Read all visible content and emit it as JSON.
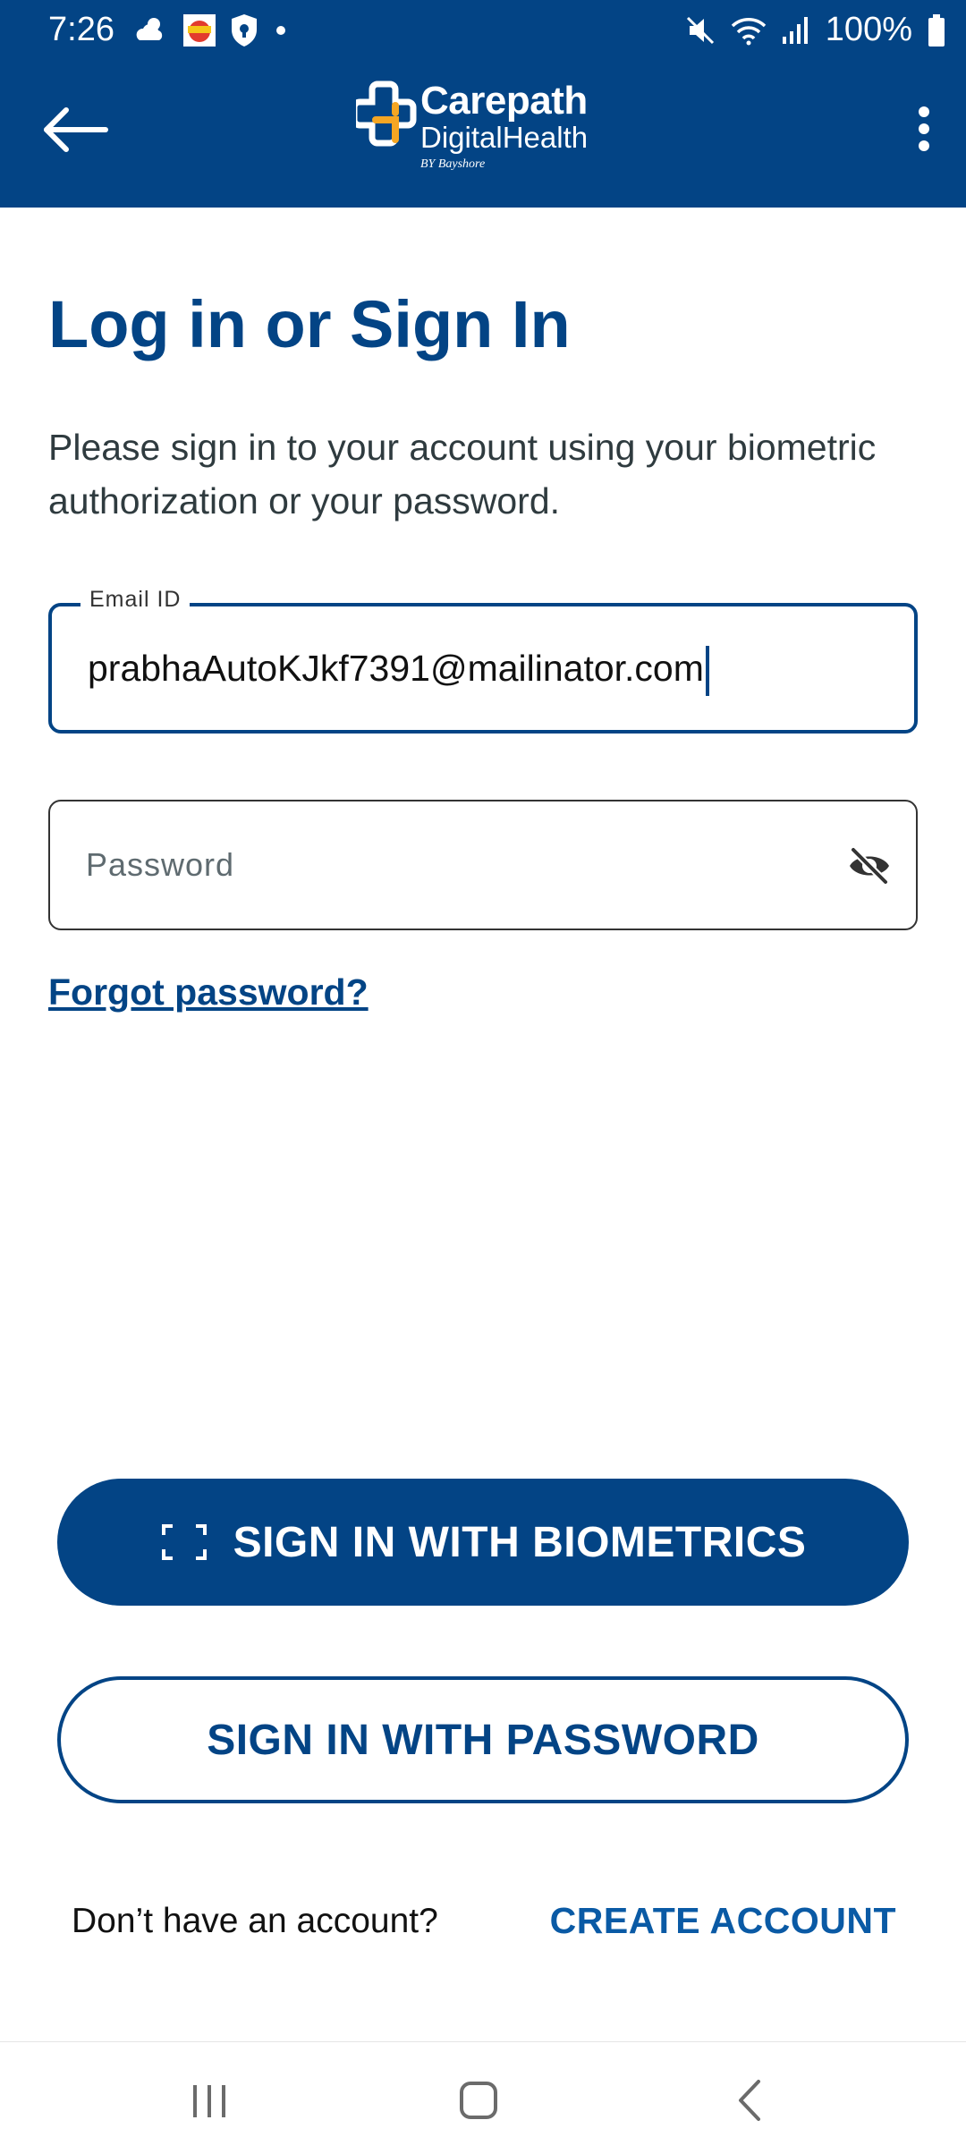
{
  "status_bar": {
    "time": "7:26",
    "battery": "100%",
    "icons": [
      "weather-icon",
      "app-badge-icon",
      "vpn-shield-icon",
      "dot-icon",
      "mute-icon",
      "wifi-icon",
      "signal-icon",
      "battery-icon"
    ]
  },
  "header": {
    "back_icon": "arrow-left-icon",
    "menu_icon": "more-vert-icon",
    "logo": {
      "line1": "Carepath",
      "line2": "DigitalHealth",
      "line3": "BY Bayshore"
    }
  },
  "main": {
    "title": "Log in or Sign In",
    "description": "Please sign in to your account using your biometric authorization or your password.",
    "email": {
      "label": "Email ID",
      "value": "prabhaAutoKJkf7391@mailinator.com"
    },
    "password": {
      "placeholder": "Password",
      "toggle_icon": "eye-off-icon"
    },
    "forgot_password": "Forgot password?",
    "biometric_button": "SIGN IN WITH BIOMETRICS",
    "password_button": "SIGN IN WITH PASSWORD",
    "no_account_text": "Don’t have an account?",
    "create_account": "CREATE ACCOUNT"
  },
  "nav_bar": {
    "items": [
      "recents-icon",
      "home-icon",
      "back-icon"
    ]
  },
  "colors": {
    "brand_blue": "#034485",
    "accent_orange": "#f5a623",
    "link_blue": "#0a5aa5"
  }
}
